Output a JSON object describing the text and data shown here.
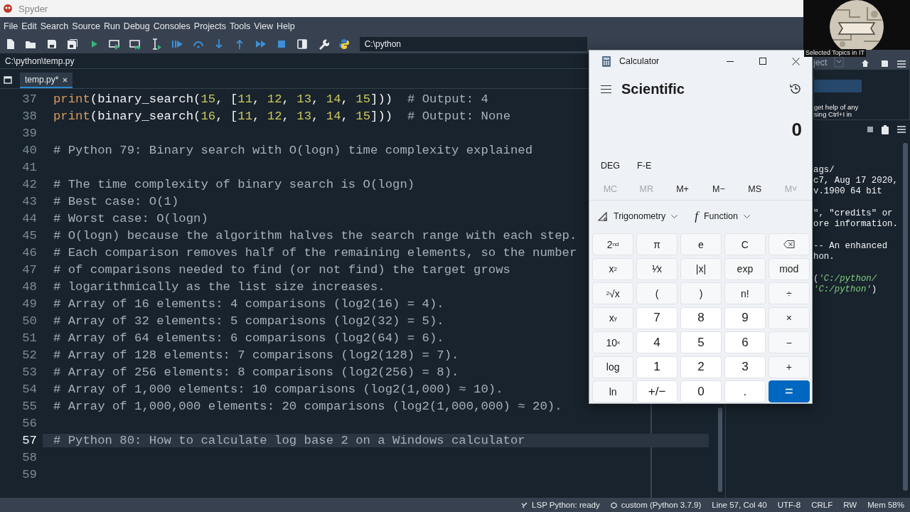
{
  "window": {
    "title": "Spyder"
  },
  "menu": [
    "File",
    "Edit",
    "Search",
    "Source",
    "Run",
    "Debug",
    "Consoles",
    "Projects",
    "Tools",
    "View",
    "Help"
  ],
  "toolbar": {
    "working_directory": "C:\\python"
  },
  "file_path": "C:\\python\\temp.py",
  "editor": {
    "tabs": [
      {
        "label": "temp.py*",
        "selected": true
      }
    ],
    "lines": [
      {
        "number": "37",
        "current": false,
        "tokens": [
          {
            "text": "print",
            "kind": "builtin"
          },
          {
            "text": "(binary_search(",
            "kind": "plain"
          },
          {
            "text": "15",
            "kind": "number"
          },
          {
            "text": ", [",
            "kind": "plain"
          },
          {
            "text": "11",
            "kind": "number"
          },
          {
            "text": ", ",
            "kind": "plain"
          },
          {
            "text": "12",
            "kind": "number"
          },
          {
            "text": ", ",
            "kind": "plain"
          },
          {
            "text": "13",
            "kind": "number"
          },
          {
            "text": ", ",
            "kind": "plain"
          },
          {
            "text": "14",
            "kind": "number"
          },
          {
            "text": ", ",
            "kind": "plain"
          },
          {
            "text": "15",
            "kind": "number"
          },
          {
            "text": "]))  ",
            "kind": "plain"
          },
          {
            "text": "# Output: 4",
            "kind": "comment"
          }
        ]
      },
      {
        "number": "38",
        "current": false,
        "tokens": [
          {
            "text": "print",
            "kind": "builtin"
          },
          {
            "text": "(binary_search(",
            "kind": "plain"
          },
          {
            "text": "16",
            "kind": "number"
          },
          {
            "text": ", [",
            "kind": "plain"
          },
          {
            "text": "11",
            "kind": "number"
          },
          {
            "text": ", ",
            "kind": "plain"
          },
          {
            "text": "12",
            "kind": "number"
          },
          {
            "text": ", ",
            "kind": "plain"
          },
          {
            "text": "13",
            "kind": "number"
          },
          {
            "text": ", ",
            "kind": "plain"
          },
          {
            "text": "14",
            "kind": "number"
          },
          {
            "text": ", ",
            "kind": "plain"
          },
          {
            "text": "15",
            "kind": "number"
          },
          {
            "text": "]))  ",
            "kind": "plain"
          },
          {
            "text": "# Output: None",
            "kind": "comment"
          }
        ]
      },
      {
        "number": "39",
        "current": false
      },
      {
        "number": "40",
        "current": false,
        "tokens": [
          {
            "text": "# Python 79: Binary search with O(logn) time complexity explained",
            "kind": "comment"
          }
        ]
      },
      {
        "number": "41",
        "current": false
      },
      {
        "number": "42",
        "current": false,
        "tokens": [
          {
            "text": "# The time complexity of binary search is O(logn)",
            "kind": "comment"
          }
        ]
      },
      {
        "number": "43",
        "current": false,
        "tokens": [
          {
            "text": "# Best case: O(1)",
            "kind": "comment"
          }
        ]
      },
      {
        "number": "44",
        "current": false,
        "tokens": [
          {
            "text": "# Worst case: O(logn)",
            "kind": "comment"
          }
        ]
      },
      {
        "number": "45",
        "current": false,
        "tokens": [
          {
            "text": "# O(logn) because the algorithm halves the search range with each step.",
            "kind": "comment"
          }
        ]
      },
      {
        "number": "46",
        "current": false,
        "tokens": [
          {
            "text": "# Each comparison removes half of the remaining elements, so the number",
            "kind": "comment"
          }
        ]
      },
      {
        "number": "47",
        "current": false,
        "tokens": [
          {
            "text": "# of comparisons needed to find (or not find) the target grows",
            "kind": "comment"
          }
        ]
      },
      {
        "number": "48",
        "current": false,
        "tokens": [
          {
            "text": "# logarithmically as the list size increases.",
            "kind": "comment"
          }
        ]
      },
      {
        "number": "49",
        "current": false,
        "tokens": [
          {
            "text": "# Array of 16 elements: 4 comparisons (log2(16) = 4).",
            "kind": "comment"
          }
        ]
      },
      {
        "number": "50",
        "current": false,
        "tokens": [
          {
            "text": "# Array of 32 elements: 5 comparisons (log2(32) = 5).",
            "kind": "comment"
          }
        ]
      },
      {
        "number": "51",
        "current": false,
        "tokens": [
          {
            "text": "# Array of 64 elements: 6 comparisons (log2(64) = 6).",
            "kind": "comment"
          }
        ]
      },
      {
        "number": "52",
        "current": false,
        "tokens": [
          {
            "text": "# Array of 128 elements: 7 comparisons (log2(128) = 7).",
            "kind": "comment"
          }
        ]
      },
      {
        "number": "53",
        "current": false,
        "tokens": [
          {
            "text": "# Array of 256 elements: 8 comparisons (log2(256) = 8).",
            "kind": "comment"
          }
        ]
      },
      {
        "number": "54",
        "current": false,
        "tokens": [
          {
            "text": "# Array of 1,000 elements: 10 comparisons (log2(1,000) ≈ 10).",
            "kind": "comment"
          }
        ]
      },
      {
        "number": "55",
        "current": false,
        "tokens": [
          {
            "text": "# Array of 1,000,000 elements: 20 comparisons (log2(1,000,000) ≈ 20).",
            "kind": "comment"
          }
        ]
      },
      {
        "number": "56",
        "current": false
      },
      {
        "number": "57",
        "current": true,
        "tokens": [
          {
            "text": "# Python 80: How to calculate log base 2 on a Windows calculator",
            "kind": "comment"
          }
        ]
      },
      {
        "number": "58",
        "current": false
      },
      {
        "number": "59",
        "current": false
      }
    ]
  },
  "right_pane": {
    "header_label": "ject",
    "help_text": [
      "get help of any",
      "sing Ctrl+I in"
    ],
    "console_blocks": [
      [
        [
          {
            "text": "ags/",
            "kind": "plain"
          }
        ],
        [
          {
            "text": "c7, Aug 17 2020,",
            "kind": "plain"
          }
        ],
        [
          {
            "text": "v.1900 64 bit",
            "kind": "plain"
          }
        ]
      ],
      [
        [
          {
            "text": "\", \"credits\" or",
            "kind": "plain"
          }
        ],
        [
          {
            "text": "ore information.",
            "kind": "plain"
          }
        ]
      ],
      [
        [
          {
            "text": "-- An enhanced",
            "kind": "plain"
          }
        ],
        [
          {
            "text": "hon.",
            "kind": "plain"
          }
        ]
      ],
      [
        [
          {
            "text": "(",
            "kind": "plain"
          },
          {
            "text": "'C:/python/",
            "kind": "string"
          }
        ],
        [
          {
            "text": "'C:/python'",
            "kind": "string"
          },
          {
            "text": ")",
            "kind": "plain"
          }
        ]
      ]
    ]
  },
  "overlay": {
    "caption": "Selected Topics in IT"
  },
  "calculator": {
    "title": "Calculator",
    "mode": "Scientific",
    "display": "0",
    "angle_unit": "DEG",
    "notation": "F-E",
    "memory": [
      {
        "label": "MC",
        "disabled": true
      },
      {
        "label": "MR",
        "disabled": true
      },
      {
        "label": "M+",
        "disabled": false
      },
      {
        "label": "M−",
        "disabled": false
      },
      {
        "label": "MS",
        "disabled": false
      },
      {
        "label": "M˅",
        "disabled": true
      }
    ],
    "dropdowns": [
      {
        "label": "Trigonometry",
        "kind": "trigonometry"
      },
      {
        "label": "Function",
        "kind": "function",
        "glyph": "f"
      }
    ],
    "keys": [
      {
        "label": "2$^{nd}$",
        "kind": "function"
      },
      {
        "label": "π",
        "kind": "function"
      },
      {
        "label": "e",
        "kind": "function"
      },
      {
        "label": "C",
        "kind": "function"
      },
      {
        "kind": "backspace"
      },
      {
        "label": "x$^{2}$",
        "kind": "function"
      },
      {
        "label": "¹⁄x",
        "kind": "function"
      },
      {
        "label": "|x|",
        "kind": "function"
      },
      {
        "label": "exp",
        "kind": "function"
      },
      {
        "label": "mod",
        "kind": "function"
      },
      {
        "label": "$^{2}$√x",
        "kind": "function"
      },
      {
        "label": "(",
        "kind": "function"
      },
      {
        "label": ")",
        "kind": "function"
      },
      {
        "label": "n!",
        "kind": "function"
      },
      {
        "label": "÷",
        "kind": "function"
      },
      {
        "label": "x$^{y}$",
        "kind": "function"
      },
      {
        "label": "7",
        "kind": "digit"
      },
      {
        "label": "8",
        "kind": "digit"
      },
      {
        "label": "9",
        "kind": "digit"
      },
      {
        "label": "×",
        "kind": "function"
      },
      {
        "label": "10$^{x}$",
        "kind": "function"
      },
      {
        "label": "4",
        "kind": "digit"
      },
      {
        "label": "5",
        "kind": "digit"
      },
      {
        "label": "6",
        "kind": "digit"
      },
      {
        "label": "−",
        "kind": "function"
      },
      {
        "label": "log",
        "kind": "function"
      },
      {
        "label": "1",
        "kind": "digit"
      },
      {
        "label": "2",
        "kind": "digit"
      },
      {
        "label": "3",
        "kind": "digit"
      },
      {
        "label": "+",
        "kind": "function"
      },
      {
        "label": "ln",
        "kind": "function"
      },
      {
        "label": "+/−",
        "kind": "digit"
      },
      {
        "label": "0",
        "kind": "digit"
      },
      {
        "label": ".",
        "kind": "digit"
      },
      {
        "label": "=",
        "kind": "equals"
      }
    ]
  },
  "status_bar": [
    {
      "text": "LSP Python: ready",
      "kind": "lsp"
    },
    {
      "text": "custom (Python 3.7.9)",
      "kind": "environment"
    },
    {
      "text": "Line 57, Col 40",
      "kind": "plain"
    },
    {
      "text": "UTF-8",
      "kind": "plain"
    },
    {
      "text": "CRLF",
      "kind": "plain"
    },
    {
      "text": "RW",
      "kind": "plain"
    },
    {
      "text": "Mem 58%",
      "kind": "plain"
    }
  ]
}
